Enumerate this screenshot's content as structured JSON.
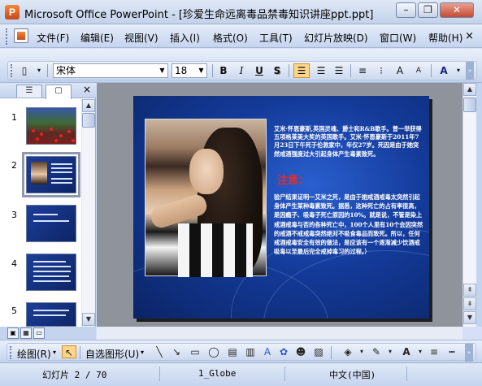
{
  "window": {
    "title": "Microsoft Office PowerPoint - [珍爱生命远离毒品禁毒知识讲座ppt.ppt]",
    "app_icon": "powerpoint-icon",
    "min_label": "–",
    "restore_label": "❐",
    "close_label": "✕"
  },
  "menu": {
    "items": [
      "文件(F)",
      "编辑(E)",
      "视图(V)",
      "插入(I)",
      "格式(O)",
      "工具(T)",
      "幻灯片放映(D)",
      "窗口(W)",
      "帮助(H)"
    ],
    "close_label": "×"
  },
  "toolbar": {
    "font_name": "宋体",
    "font_size": "18",
    "bold": "B",
    "italic": "I",
    "underline": "U",
    "shadow": "S",
    "font_color_label": "A"
  },
  "left_pane": {
    "tab_outline_icon": "outline-icon",
    "tab_slides_icon": "slides-icon",
    "close_label": "×",
    "slide_numbers": [
      "1",
      "2",
      "3",
      "4",
      "5"
    ]
  },
  "slide": {
    "paragraph1": "艾米·怀恩豪斯,英国灵魂、爵士和R&B歌手。曾一举获得五项格莱美大奖的英国歌手。艾米·怀恩豪斯于2011年7月23日下午死于伦敦家中，年仅27岁。死因是由于她突然戒酒强度过大引起身体产生毒素致死。",
    "note_title": "注意：",
    "paragraph2": "验尸结果证明一艾米之死，是由于她戒酒戒毒太突然引起身体产生某种毒素致死。据悉，这种死亡的占有率很高，是因瘾子、吸毒子死亡原因的10%。就是说，不管是染上戒酒戒毒与否的各种死亡中，100个人里有10个会因突然的戒酒不戒戒毒突然绝对不吸食毒品而致死。所以，任何戒酒戒毒安全有效的做法，是应该有一个逐渐减少饮酒戒吸毒以至最后完全戒掉毒习的过程。）"
  },
  "drawing_toolbar": {
    "draw_label": "绘图(R)",
    "autoshapes_label": "自选图形(U)"
  },
  "status": {
    "slide_pos": "幻灯片 2 / 70",
    "design": "1_Globe",
    "language": "中文(中国)"
  }
}
